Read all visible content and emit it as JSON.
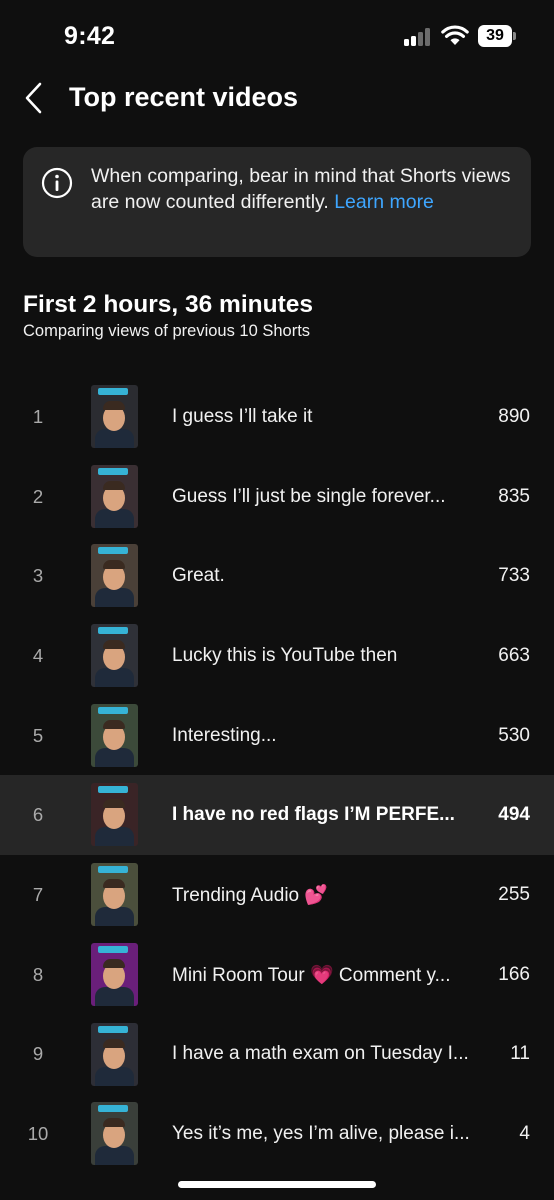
{
  "status": {
    "time": "9:42",
    "battery": "39"
  },
  "header": {
    "title": "Top recent videos"
  },
  "notice": {
    "text": "When comparing, bear in mind that Shorts views are now counted differently. ",
    "link": "Learn more"
  },
  "section": {
    "title": "First 2 hours, 36 minutes",
    "subtitle": "Comparing views of previous 10 Shorts"
  },
  "videos": [
    {
      "rank": "1",
      "title": "I guess I’ll take it",
      "views": "890",
      "thumb_bg": "#2b2c31"
    },
    {
      "rank": "2",
      "title": "Guess I’ll just be single forever...",
      "views": "835",
      "thumb_bg": "#3a2f33"
    },
    {
      "rank": "3",
      "title": "Great.",
      "views": "733",
      "thumb_bg": "#4a4038"
    },
    {
      "rank": "4",
      "title": "Lucky this is YouTube then",
      "views": "663",
      "thumb_bg": "#2f3138"
    },
    {
      "rank": "5",
      "title": "Interesting...",
      "views": "530",
      "thumb_bg": "#3c4a3a"
    },
    {
      "rank": "6",
      "title": "I have no red flags I’M PERFE...",
      "views": "494",
      "thumb_bg": "#3a2426"
    },
    {
      "rank": "7",
      "title": "Trending Audio 💕",
      "views": "255",
      "thumb_bg": "#4b4f3c"
    },
    {
      "rank": "8",
      "title": "Mini Room Tour 💗 Comment y...",
      "views": "166",
      "thumb_bg": "#6a1f7a"
    },
    {
      "rank": "9",
      "title": "I have a math exam on Tuesday I...",
      "views": "11",
      "thumb_bg": "#2d2e36"
    },
    {
      "rank": "10",
      "title": "Yes it’s me, yes I’m alive, please i...",
      "views": "4",
      "thumb_bg": "#3a3f3a"
    }
  ],
  "highlighted_rank": "6",
  "colors": {
    "background": "#0f0f0f",
    "card": "#272727",
    "link": "#3ea6ff",
    "highlight_row": "#262626"
  }
}
